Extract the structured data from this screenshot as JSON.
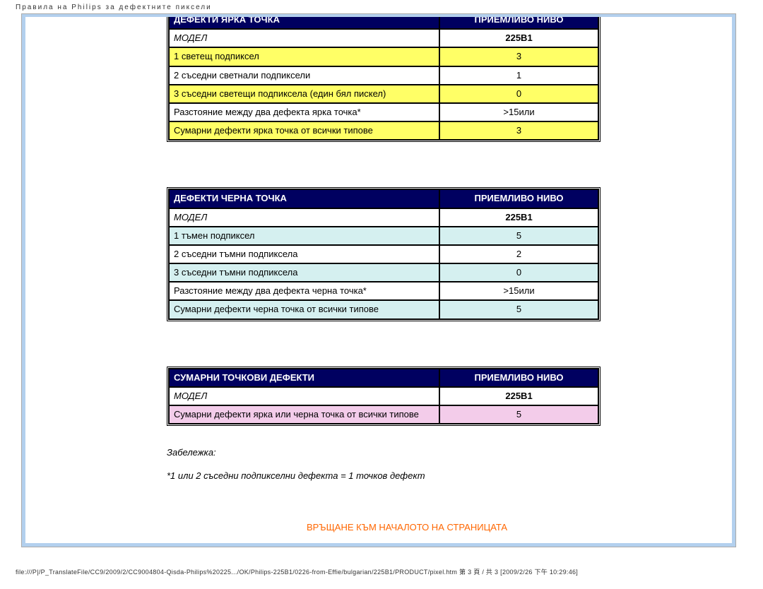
{
  "header": "Правила  на  Philips  за  дефектните  пиксели",
  "tables": {
    "bright": {
      "hdr_left": "ДЕФЕКТИ ЯРКА ТОЧКА",
      "hdr_right": "ПРИЕМЛИВО НИВО",
      "model_label": "МОДЕЛ",
      "model_value": "225B1",
      "rows": [
        {
          "label": "1 светещ подпиксел",
          "value": "3"
        },
        {
          "label": "2 съседни светнали подпиксели",
          "value": "1"
        },
        {
          "label": "3 съседни светещи подпиксела (един бял пискел)",
          "value": "0"
        },
        {
          "label": "Разстояние между два дефекта ярка точка*",
          "value": ">15или"
        },
        {
          "label": "Сумарни дефекти ярка точка от всички типове",
          "value": "3"
        }
      ]
    },
    "dark": {
      "hdr_left": "ДЕФЕКТИ ЧЕРНА ТОЧКА",
      "hdr_right": "ПРИЕМЛИВО НИВО",
      "model_label": "МОДЕЛ",
      "model_value": "225B1",
      "rows": [
        {
          "label": "1 тъмен подпиксел",
          "value": "5"
        },
        {
          "label": "2 съседни тъмни подпиксела",
          "value": "2"
        },
        {
          "label": "3 съседни тъмни подпиксела",
          "value": "0"
        },
        {
          "label": "Разстояние между два дефекта черна точка*",
          "value": ">15или"
        },
        {
          "label": "Сумарни дефекти черна точка от всички типове",
          "value": "5"
        }
      ]
    },
    "total": {
      "hdr_left": "СУМАРНИ ТОЧКОВИ ДЕФЕКТИ",
      "hdr_right": "ПРИЕМЛИВО НИВО",
      "model_label": "МОДЕЛ",
      "model_value": "225B1",
      "rows": [
        {
          "label": "Сумарни дефекти ярка или черна точка от всички типове",
          "value": "5"
        }
      ]
    }
  },
  "note_label": "Забележка:",
  "note_text": "*1 или 2 съседни подпикселни дефекта = 1 точков дефект",
  "back_link": "ВРЪЩАНЕ КЪМ НАЧАЛОТО НА СТРАНИЦАТА",
  "footer_path": "file:///P|/P_TranslateFile/CC9/2009/2/CC9004804-Qisda-Philips%20225.../OK/Philips-225B1/0226-from-Effie/bulgarian/225B1/PRODUCT/pixel.htm 第 3 頁 / 共 3  [2009/2/26 下午 10:29:46]"
}
